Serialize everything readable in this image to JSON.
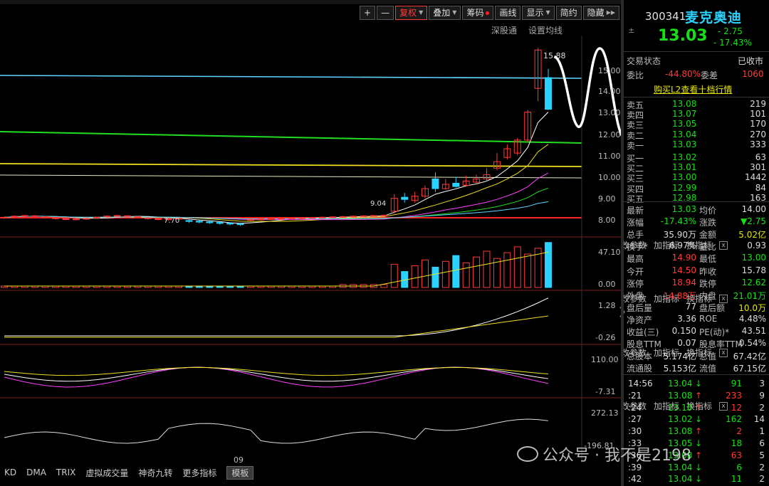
{
  "toolbar": {
    "plus": "+",
    "minus": "—",
    "fuquan": "复权",
    "diejia": "叠加",
    "chouma": "筹码",
    "huaxian": "画线",
    "xianshi": "显示",
    "jianyue": "简约",
    "yincang": "隐藏"
  },
  "subbar": {
    "shengutong": "深股通",
    "shezhi": "设置均线"
  },
  "main_chart": {
    "high_label": "15.88",
    "low_label": "7.70",
    "mid_label": "9.04",
    "yticks": [
      "15.00",
      "14.00",
      "13.00",
      "12.00",
      "11.00",
      "10.00",
      "9.00",
      "8.00"
    ]
  },
  "pane_tools": {
    "gai": "改参数",
    "jia": "加指标",
    "huan": "换指标",
    "close": "x"
  },
  "pane_labels": {
    "vol_top": "47.10",
    "vol_bot": "0.00",
    "p2_top": "1.28",
    "p2_bot": "-0.26",
    "p3_top": "110.00",
    "p3_bot": "-7.31",
    "p4_top": "272.13",
    "p4_bot": "-196.81",
    "x_label": "09"
  },
  "bottom_tabs": [
    "KD",
    "DMA",
    "TRIX",
    "虚拟成交量",
    "神奇九转",
    "更多指标",
    "模板"
  ],
  "stock": {
    "code": "300341",
    "name": "麦克奥迪",
    "price": "13.03",
    "change": "- 2.75",
    "change_pct": "- 17.43%",
    "pm": "±"
  },
  "status": {
    "label": "交易状态",
    "value": "已收市"
  },
  "weibi": {
    "label": "委比",
    "value": "-44.80%",
    "label2": "委差",
    "value2": "1060"
  },
  "l2_link": "购买L2查看十档行情",
  "asks": [
    {
      "label": "卖五",
      "price": "13.08",
      "vol": "219"
    },
    {
      "label": "卖四",
      "price": "13.07",
      "vol": "101"
    },
    {
      "label": "卖三",
      "price": "13.05",
      "vol": "170"
    },
    {
      "label": "卖二",
      "price": "13.04",
      "vol": "270"
    },
    {
      "label": "卖一",
      "price": "13.03",
      "vol": "333"
    }
  ],
  "bids": [
    {
      "label": "买一",
      "price": "13.02",
      "vol": "63"
    },
    {
      "label": "买二",
      "price": "13.01",
      "vol": "301"
    },
    {
      "label": "买三",
      "price": "13.00",
      "vol": "1442"
    },
    {
      "label": "买四",
      "price": "12.99",
      "vol": "84"
    },
    {
      "label": "买五",
      "price": "12.98",
      "vol": "163"
    }
  ],
  "quote": [
    {
      "l": "最新",
      "v": "13.03",
      "vc": "g",
      "l2": "均价",
      "v2": "14.00",
      "v2c": "w"
    },
    {
      "l": "涨幅",
      "v": "-17.43%",
      "vc": "g",
      "l2": "涨跌",
      "v2": "▼2.75",
      "v2c": "g"
    },
    {
      "l": "总手",
      "v": "35.90万",
      "vc": "w",
      "l2": "金额",
      "v2": "5.02亿",
      "v2c": "y"
    },
    {
      "l": "换手*",
      "v": "6.97%",
      "vc": "w",
      "l2": "量比",
      "v2": "0.93",
      "v2c": "w"
    },
    {
      "l": "最高",
      "v": "14.90",
      "vc": "r",
      "l2": "最低",
      "v2": "13.00",
      "v2c": "g"
    },
    {
      "l": "今开",
      "v": "14.50",
      "vc": "r",
      "l2": "昨收",
      "v2": "15.78",
      "v2c": "w"
    },
    {
      "l": "涨停",
      "v": "18.94",
      "vc": "r",
      "l2": "跌停",
      "v2": "12.62",
      "v2c": "g"
    },
    {
      "l": "外盘",
      "v": "14.88万",
      "vc": "r",
      "l2": "内盘",
      "v2": "21.01万",
      "v2c": "g"
    },
    {
      "l": "盘后量",
      "v": "77",
      "vc": "w",
      "l2": "盘后额",
      "v2": "10.0万",
      "v2c": "y"
    },
    {
      "l": "净资产",
      "v": "3.36",
      "vc": "w",
      "l2": "ROE",
      "v2": "4.48%",
      "v2c": "w"
    },
    {
      "l": "收益(三)",
      "v": "0.150",
      "vc": "w",
      "l2": "PE(动)*",
      "v2": "43.51",
      "v2c": "w"
    },
    {
      "l": "股息TTM",
      "v": "0.07",
      "vc": "w",
      "l2": "股息率TTM",
      "v2": "0.54%",
      "v2c": "w"
    },
    {
      "l": "总股本",
      "v": "5.174亿",
      "vc": "w",
      "l2": "总值",
      "v2": "67.42亿",
      "v2c": "w"
    },
    {
      "l": "流通股",
      "v": "5.153亿",
      "vc": "w",
      "l2": "流值",
      "v2": "67.15亿",
      "v2c": "w"
    }
  ],
  "ticks": [
    {
      "t": "14:56",
      "p": "13.04",
      "a": "↓",
      "ac": "g",
      "v": "91",
      "n": "3"
    },
    {
      "t": ":21",
      "p": "13.08",
      "a": "↑",
      "ac": "r",
      "v": "233",
      "n": "9"
    },
    {
      "t": ":24",
      "p": "13.10",
      "a": "↑",
      "ac": "r",
      "v": "12",
      "n": "2"
    },
    {
      "t": ":27",
      "p": "13.02",
      "a": "↓",
      "ac": "g",
      "v": "162",
      "n": "14"
    },
    {
      "t": ":30",
      "p": "13.08",
      "a": "↑",
      "ac": "r",
      "v": "2",
      "n": "1"
    },
    {
      "t": ":33",
      "p": "13.05",
      "a": "↓",
      "ac": "g",
      "v": "18",
      "n": "6"
    },
    {
      "t": ":36",
      "p": "13.08",
      "a": "↑",
      "ac": "r",
      "v": "63",
      "n": "5"
    },
    {
      "t": ":39",
      "p": "13.04",
      "a": "↓",
      "ac": "g",
      "v": "6",
      "n": "2"
    },
    {
      "t": ":42",
      "p": "13.04",
      "a": "↓",
      "ac": "g",
      "v": "11",
      "n": "2"
    }
  ],
  "watermark": "公众号 · 我不是2198"
}
